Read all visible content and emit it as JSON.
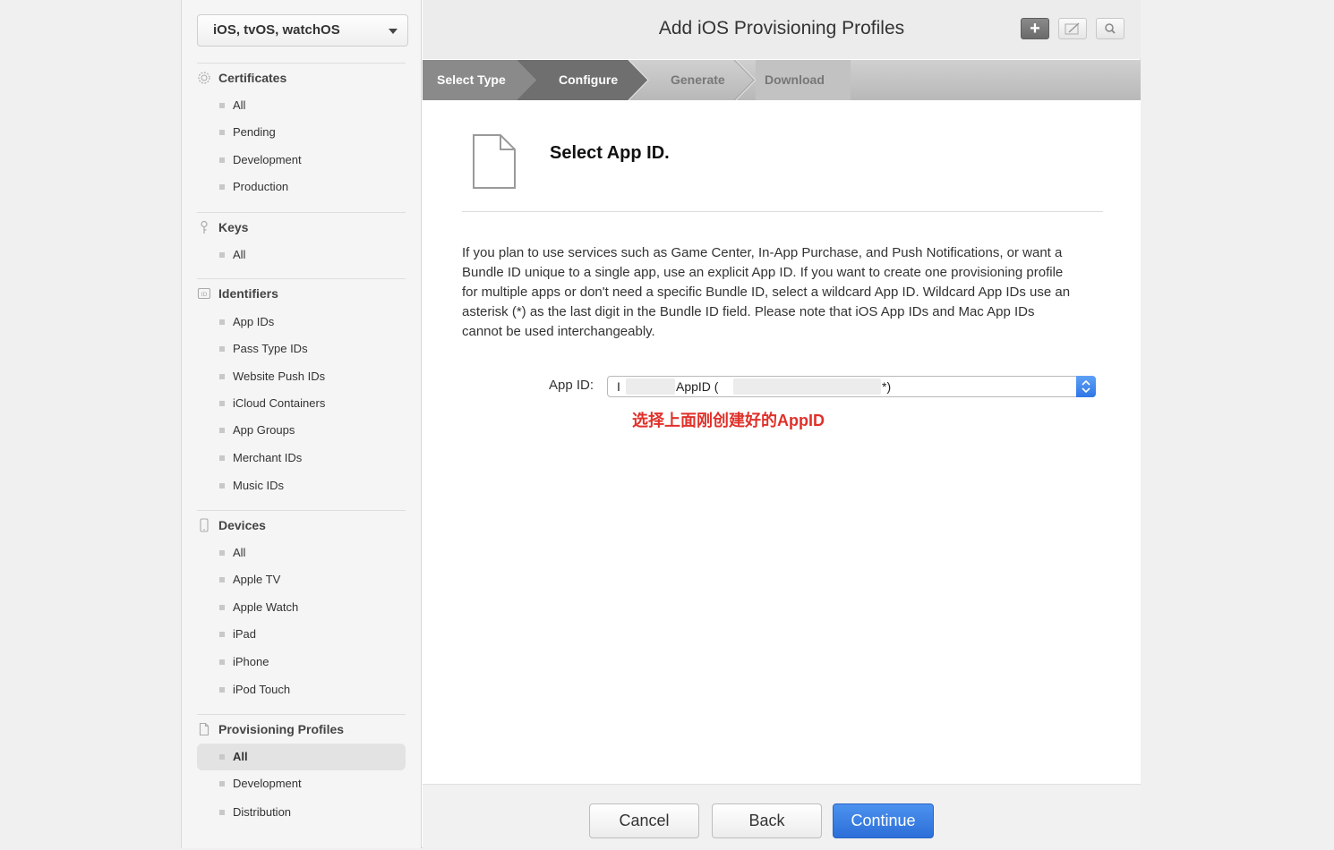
{
  "platform_select": {
    "value": "iOS, tvOS, watchOS"
  },
  "sidebar": {
    "certificates": {
      "label": "Certificates",
      "items": [
        "All",
        "Pending",
        "Development",
        "Production"
      ]
    },
    "keys": {
      "label": "Keys",
      "items": [
        "All"
      ]
    },
    "identifiers": {
      "label": "Identifiers",
      "items": [
        "App IDs",
        "Pass Type IDs",
        "Website Push IDs",
        "iCloud Containers",
        "App Groups",
        "Merchant IDs",
        "Music IDs"
      ]
    },
    "devices": {
      "label": "Devices",
      "items": [
        "All",
        "Apple TV",
        "Apple Watch",
        "iPad",
        "iPhone",
        "iPod Touch"
      ]
    },
    "profiles": {
      "label": "Provisioning Profiles",
      "items": [
        "All",
        "Development",
        "Distribution"
      ],
      "active_index": 0
    }
  },
  "header": {
    "title": "Add iOS Provisioning Profiles"
  },
  "toolbar": {
    "add_icon": "plus-icon",
    "edit_icon": "edit-icon",
    "search_icon": "search-icon"
  },
  "steps": [
    "Select Type",
    "Configure",
    "Generate",
    "Download"
  ],
  "step_active_index": 1,
  "content": {
    "heading": "Select App ID.",
    "paragraph": "If you plan to use services such as Game Center, In-App Purchase, and Push Notifications, or want a Bundle ID unique to a single app, use an explicit App ID. If you want to create one provisioning profile for multiple apps or don't need a specific Bundle ID, select a wildcard App ID. Wildcard App IDs use an asterisk (*) as the last digit in the Bundle ID field. Please note that iOS App IDs and Mac App IDs cannot be used interchangeably.",
    "appid_label": "App ID:",
    "appid_value_prefix": "I",
    "appid_value_mid": "AppID (",
    "appid_value_suffix": "*)",
    "annotation": "选择上面刚创建好的AppID"
  },
  "footer": {
    "cancel": "Cancel",
    "back": "Back",
    "continue": "Continue"
  },
  "colors": {
    "accent": "#2c6fd9",
    "annotation": "#e0312a",
    "step_active": "#6f6f6f"
  }
}
